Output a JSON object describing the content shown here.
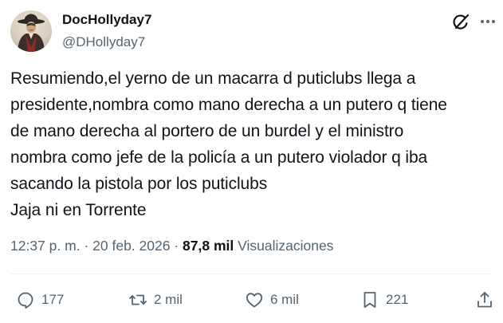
{
  "author": {
    "display_name": "DocHollyday7",
    "handle": "@DHollyday7",
    "avatar_icon": "cowboy-avatar"
  },
  "header_icons": {
    "grok": "grok-icon",
    "more": "more-icon"
  },
  "tweet": {
    "text": "Resumiendo,el yerno de un macarra d puticlubs llega a\npresidente,nombra como mano derecha a un putero q tiene\nde mano derecha al portero de un burdel y el ministro\nnombra como jefe de la policía a un putero violador q iba\nsacando la pistola por los puticlubs\nJaja ni en Torrente"
  },
  "meta": {
    "time": "12:37 p. m.",
    "separator": "·",
    "date": "20 feb. 2026",
    "views_count": "87,8 mil",
    "views_label": "Visualizaciones"
  },
  "actions": {
    "reply_count": "177",
    "repost_count": "2 mil",
    "like_count": "6 mil",
    "bookmark_count": "221"
  },
  "colors": {
    "text_primary": "#0f1419",
    "text_secondary": "#536471",
    "divider": "#eff3f4"
  }
}
